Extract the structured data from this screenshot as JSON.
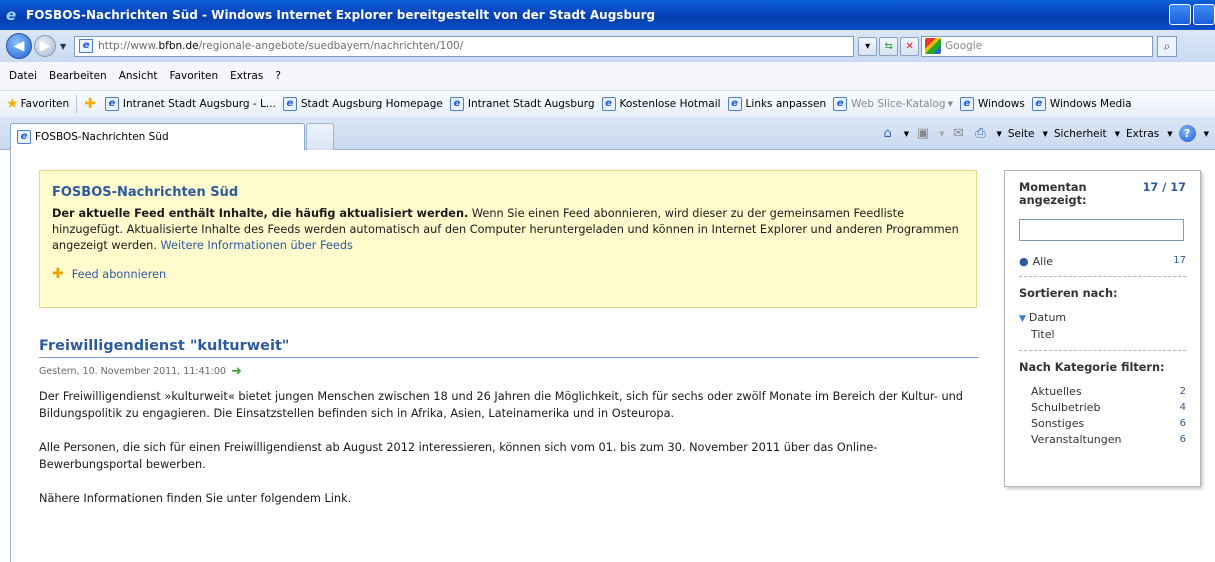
{
  "window": {
    "title": "FOSBOS-Nachrichten Süd - Windows Internet Explorer bereitgestellt von der Stadt Augsburg"
  },
  "address": {
    "url_prefix": "http://www.",
    "url_domain": "bfbn.de",
    "url_path": "/regionale-angebote/suedbayern/nachrichten/100/",
    "search_placeholder": "Google"
  },
  "menu": [
    "Datei",
    "Bearbeiten",
    "Ansicht",
    "Favoriten",
    "Extras",
    "?"
  ],
  "favorites": {
    "label": "Favoriten",
    "items": [
      {
        "label": "Intranet Stadt Augsburg - L..."
      },
      {
        "label": "Stadt Augsburg Homepage"
      },
      {
        "label": "Intranet Stadt Augsburg"
      },
      {
        "label": "Kostenlose Hotmail"
      },
      {
        "label": "Links anpassen"
      },
      {
        "label": "Web Slice-Katalog"
      },
      {
        "label": "Windows"
      },
      {
        "label": "Windows Media"
      }
    ]
  },
  "tab": {
    "label": "FOSBOS-Nachrichten Süd"
  },
  "commands": {
    "page": "Seite",
    "security": "Sicherheit",
    "extras": "Extras"
  },
  "feed": {
    "title": "FOSBOS-Nachrichten Süd",
    "intro_bold": "Der aktuelle Feed enthält Inhalte, die häufig aktualisiert werden.",
    "intro_text": " Wenn Sie einen Feed abonnieren, wird dieser zu der gemeinsamen Feedliste hinzugefügt. Aktualisierte Inhalte des Feeds werden automatisch auf den Computer heruntergeladen und können in Internet Explorer und anderen Programmen angezeigt werden. ",
    "more_link": "Weitere Informationen über Feeds",
    "subscribe": "Feed abonnieren"
  },
  "article": {
    "title": "Freiwilligendienst \"kulturweit\"",
    "date": "Gestern, 10. November 2011, 11:41:00",
    "paragraphs": [
      "Der Freiwilligendienst »kulturweit« bietet jungen Menschen zwischen 18 und 26 Jahren die Möglichkeit, sich für sechs oder zwölf Monate im Bereich der Kultur- und Bildungspolitik zu engagieren. Die Einsatzstellen befinden sich in Afrika, Asien, Lateinamerika und in Osteuropa.",
      "Alle Personen, die sich für einen Freiwilligendienst ab August 2012 interessieren, können sich vom 01. bis zum 30. November 2011 über das Online-Bewerbungsportal bewerben.",
      "Nähere Informationen finden Sie unter folgendem Link."
    ]
  },
  "sidebar": {
    "shown_label": "Momentan angezeigt:",
    "shown_count": "17 / 17",
    "all_label": "Alle",
    "all_count": "17",
    "sort_heading": "Sortieren nach:",
    "sort_date": "Datum",
    "sort_title": "Titel",
    "filter_heading": "Nach Kategorie filtern:",
    "categories": [
      {
        "label": "Aktuelles",
        "count": "2"
      },
      {
        "label": "Schulbetrieb",
        "count": "4"
      },
      {
        "label": "Sonstiges",
        "count": "6"
      },
      {
        "label": "Veranstaltungen",
        "count": "6"
      }
    ]
  }
}
